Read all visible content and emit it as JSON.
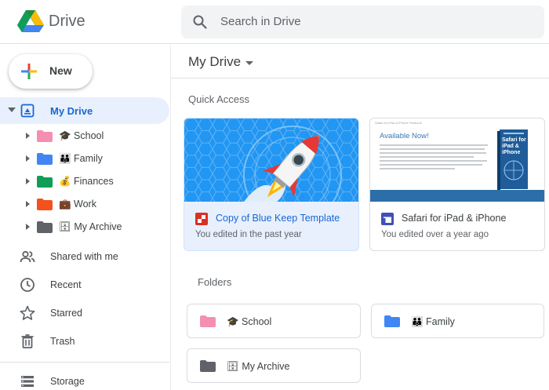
{
  "app": {
    "name": "Drive"
  },
  "search": {
    "placeholder": "Search in Drive"
  },
  "sidebar": {
    "new_label": "New",
    "my_drive_label": "My Drive",
    "tree": [
      {
        "label": "🎓 School",
        "color": "#f48fb1"
      },
      {
        "label": "👪 Family",
        "color": "#4285f4"
      },
      {
        "label": "💰 Finances",
        "color": "#0f9d58"
      },
      {
        "label": "💼 Work",
        "color": "#f4511e"
      },
      {
        "label": "🗄 My Archive",
        "color": "#5f6368"
      }
    ],
    "nav": [
      {
        "label": "Shared with me",
        "icon": "shared-icon"
      },
      {
        "label": "Recent",
        "icon": "clock-icon"
      },
      {
        "label": "Starred",
        "icon": "star-icon"
      },
      {
        "label": "Trash",
        "icon": "trash-icon"
      },
      {
        "label": "Storage",
        "icon": "storage-icon"
      }
    ]
  },
  "main": {
    "title": "My Drive",
    "quick_access_label": "Quick Access",
    "quick_access": [
      {
        "name": "Copy of Blue Keep Template",
        "subtitle": "You edited in the past year",
        "icon": "slides-icon"
      },
      {
        "name": "Safari for iPad & iPhone",
        "subtitle": "You edited over a year ago",
        "icon": "docs-icon",
        "thumb": {
          "header": "Safari for iPad & iPhone Textbook",
          "headline": "Available Now!",
          "book_title": "Safari for iPad & iPhone"
        }
      }
    ],
    "folders_label": "Folders",
    "folders": [
      {
        "label": "🎓 School",
        "color": "#f48fb1"
      },
      {
        "label": "👪 Family",
        "color": "#4285f4"
      },
      {
        "label": "🗄 My Archive",
        "color": "#5f6368"
      }
    ]
  }
}
